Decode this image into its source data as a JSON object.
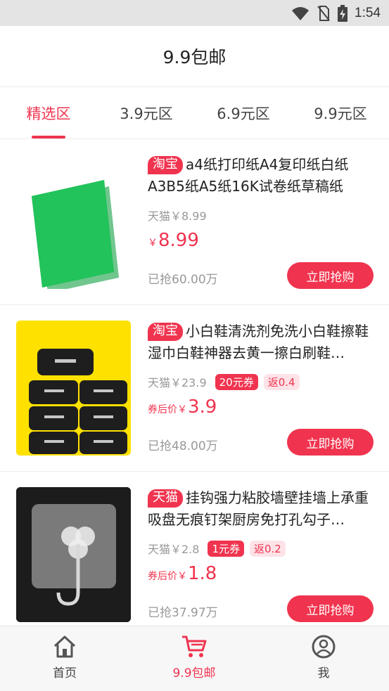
{
  "status": {
    "time": "1:54"
  },
  "header": {
    "title": "9.9包邮"
  },
  "tabs": [
    {
      "label": "精选区",
      "active": true
    },
    {
      "label": "3.9元区",
      "active": false
    },
    {
      "label": "6.9元区",
      "active": false
    },
    {
      "label": "9.9元区",
      "active": false
    }
  ],
  "products": [
    {
      "source": "淘宝",
      "title": "a4纸打印纸A4复印纸白纸A3B5纸A5纸16K试卷纸草稿纸",
      "orig_price": "天猫￥8.99",
      "coupon": "",
      "rebate": "",
      "price_prefix": "￥",
      "price": "8.99",
      "sold": "已抢60.00万",
      "button": "立即抢购"
    },
    {
      "source": "淘宝",
      "title": "小白鞋清洗剂免洗小白鞋擦鞋湿巾白鞋神器去黄一擦白刷鞋…",
      "orig_price": "天猫￥23.9",
      "coupon": "20元券",
      "rebate": "返0.4",
      "price_prefix": "券后价￥",
      "price": "3.9",
      "sold": "已抢48.00万",
      "button": "立即抢购"
    },
    {
      "source": "天猫",
      "title": "挂钩强力粘胶墙壁挂墙上承重吸盘无痕钉架厨房免打孔勾子…",
      "orig_price": "天猫￥2.8",
      "coupon": "1元券",
      "rebate": "返0.2",
      "price_prefix": "券后价￥",
      "price": "1.8",
      "sold": "已抢37.97万",
      "button": "立即抢购"
    }
  ],
  "bottom_nav": [
    {
      "label": "首页",
      "icon": "home-icon",
      "active": false
    },
    {
      "label": "9.9包邮",
      "icon": "cart-icon",
      "active": true
    },
    {
      "label": "我",
      "icon": "user-icon",
      "active": false
    }
  ],
  "colors": {
    "accent": "#f0344f",
    "status_bar": "#e4e4e4"
  }
}
